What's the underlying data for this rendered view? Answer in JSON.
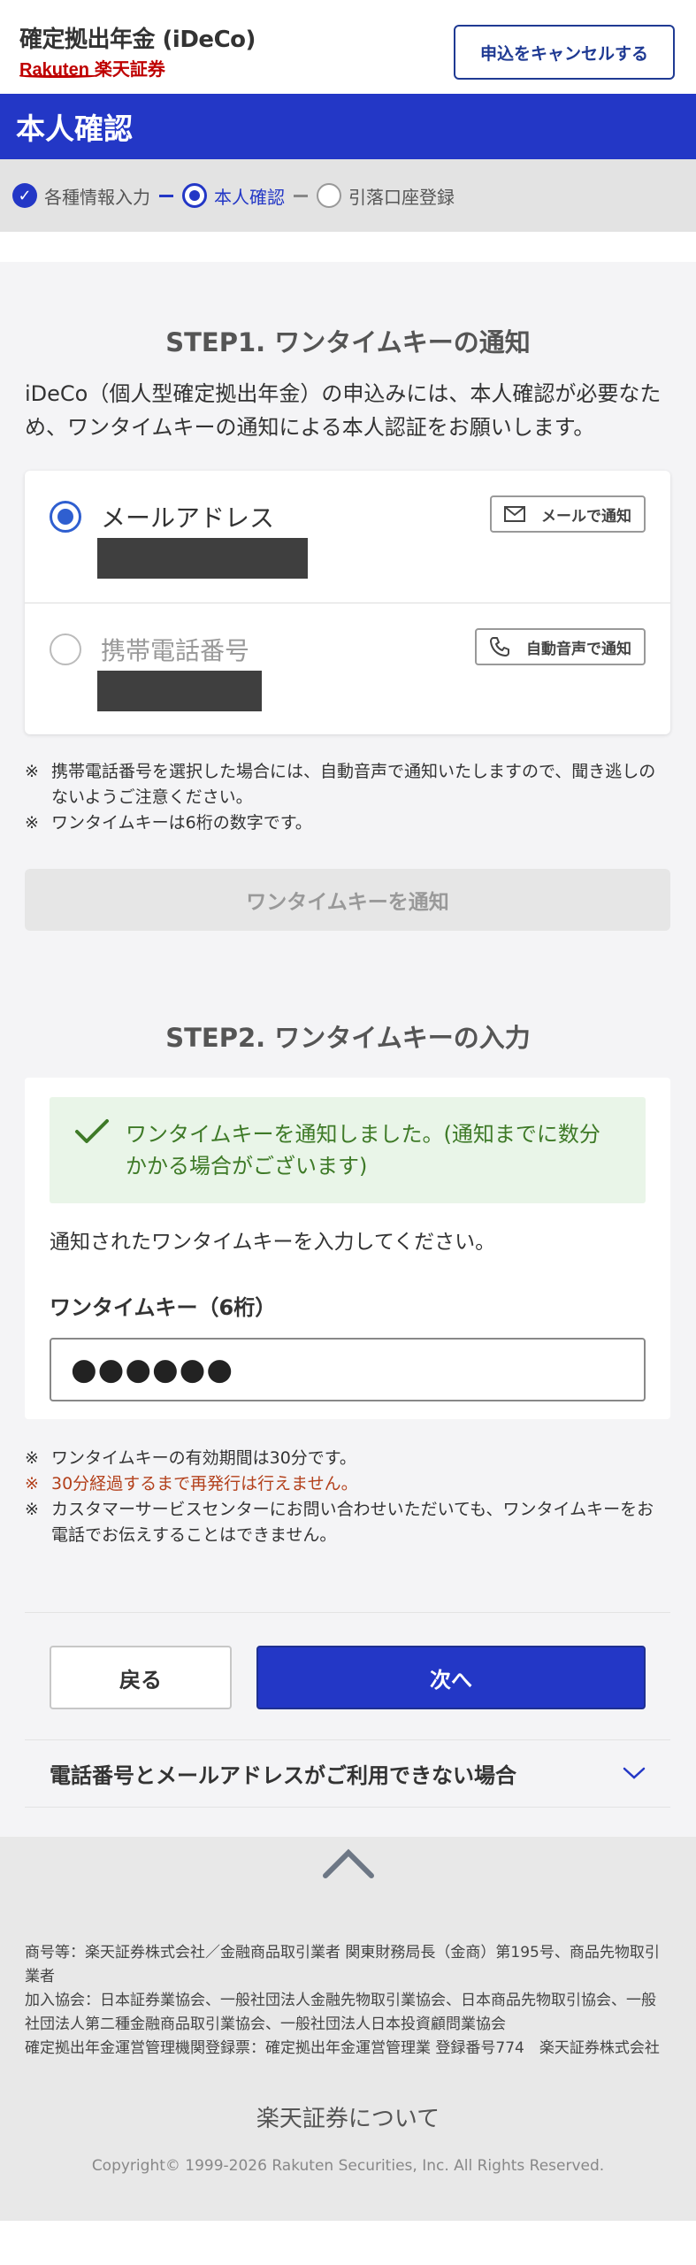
{
  "header": {
    "title": "確定拠出年金 (iDeCo)",
    "logo_rakuten": "Rakuten",
    "logo_securities": "楽天証券",
    "cancel_label": "申込をキャンセルする"
  },
  "page_title": "本人確認",
  "stepper": {
    "steps": [
      {
        "label": "各種情報入力",
        "state": "done"
      },
      {
        "label": "本人確認",
        "state": "current"
      },
      {
        "label": "引落口座登録",
        "state": "todo"
      }
    ]
  },
  "step1": {
    "title": "STEP1. ワンタイムキーの通知",
    "intro": "iDeCo（個人型確定拠出年金）の申込みには、本人確認が必要なため、ワンタイムキーの通知による本人認証をお願いします。",
    "options": [
      {
        "label": "メールアドレス",
        "selected": true,
        "notify_label": "メールで通知",
        "icon": "mail-icon"
      },
      {
        "label": "携帯電話番号",
        "selected": false,
        "notify_label": "自動音声で通知",
        "icon": "phone-icon"
      }
    ],
    "notes": [
      {
        "mark": "※",
        "text": "携帯電話番号を選択した場合には、自動音声で通知いたしますので、聞き逃しのないようご注意ください。"
      },
      {
        "mark": "※",
        "text": "ワンタイムキーは6桁の数字です。"
      }
    ],
    "notify_button": "ワンタイムキーを通知"
  },
  "step2": {
    "title": "STEP2. ワンタイムキーの入力",
    "success_message": "ワンタイムキーを通知しました。(通知までに数分かかる場合がございます)",
    "instruction": "通知されたワンタイムキーを入力してください。",
    "field_label": "ワンタイムキー（6桁）",
    "field_value": "●●●●●●",
    "notes": [
      {
        "mark": "※",
        "text": "ワンタイムキーの有効期間は30分です。",
        "warn": false
      },
      {
        "mark": "※",
        "text": "30分経過するまで再発行は行えません。",
        "warn": true
      },
      {
        "mark": "※",
        "text": "カスタマーサービスセンターにお問い合わせいただいても、ワンタイムキーをお電話でお伝えすることはできません。",
        "warn": false
      }
    ]
  },
  "actions": {
    "back": "戻る",
    "next": "次へ"
  },
  "accordion": {
    "label": "電話番号とメールアドレスがご利用できない場合"
  },
  "footer": {
    "legal": [
      "商号等：楽天証券株式会社／金融商品取引業者 関東財務局長（金商）第195号、商品先物取引業者",
      "加入協会：日本証券業協会、一般社団法人金融先物取引業協会、日本商品先物取引協会、一般社団法人第二種金融商品取引業協会、一般社団法人日本投資顧問業協会",
      "確定拠出年金運営管理機関登録票：確定拠出年金運営管理業 登録番号774　楽天証券株式会社"
    ],
    "about": "楽天証券について",
    "copyright": "Copyright© 1999-2026 Rakuten Securities, Inc. All Rights Reserved."
  },
  "colors": {
    "brand_blue": "#2337c6",
    "rakuten_red": "#bf0000",
    "success_green": "#3e7a27",
    "warning_red": "#b3411c"
  }
}
